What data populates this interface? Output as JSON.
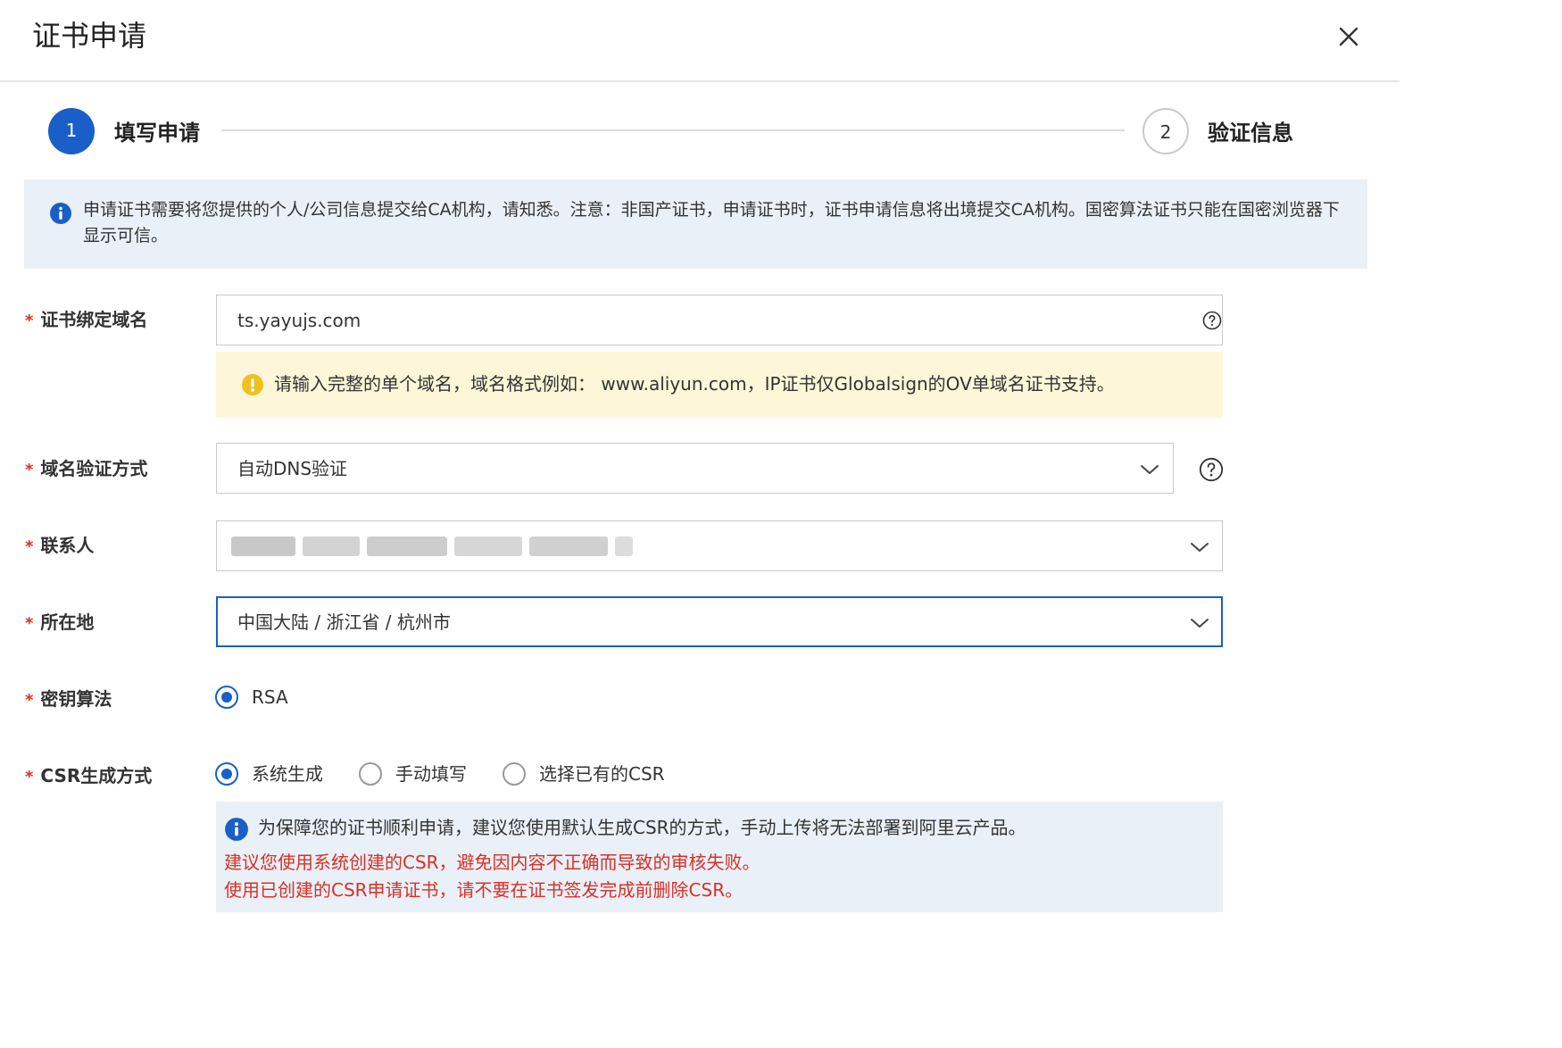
{
  "dialog": {
    "title": "证书申请"
  },
  "steps": [
    {
      "number": "1",
      "label": "填写申请"
    },
    {
      "number": "2",
      "label": "验证信息"
    }
  ],
  "notice": {
    "text": "申请证书需要将您提供的个人/公司信息提交给CA机构，请知悉。注意：非国产证书，申请证书时，证书申请信息将出境提交CA机构。国密算法证书只能在国密浏览器下显示可信。"
  },
  "form": {
    "required_mark": "*",
    "domain": {
      "label": "证书绑定域名",
      "value": "ts.yayujs.com",
      "hint": "请输入完整的单个域名，域名格式例如： www.aliyun.com，IP证书仅Globalsign的OV单域名证书支持。"
    },
    "verify_method": {
      "label": "域名验证方式",
      "value": "自动DNS验证"
    },
    "contact": {
      "label": "联系人"
    },
    "location": {
      "label": "所在地",
      "value": "中国大陆 / 浙江省 / 杭州市"
    },
    "algorithm": {
      "label": "密钥算法",
      "options": [
        {
          "label": "RSA",
          "selected": true
        }
      ]
    },
    "csr": {
      "label": "CSR生成方式",
      "options": [
        {
          "label": "系统生成",
          "selected": true
        },
        {
          "label": "手动填写",
          "selected": false
        },
        {
          "label": "选择已有的CSR",
          "selected": false
        }
      ],
      "info": {
        "line1": "为保障您的证书顺利申请，建议您使用默认生成CSR的方式，手动上传将无法部署到阿里云产品。",
        "line2": "建议您使用系统创建的CSR，避免因内容不正确而导致的审核失败。",
        "line3": "使用已创建的CSR申请证书，请不要在证书签发完成前删除CSR。"
      }
    }
  },
  "colors": {
    "primary": "#1a5fc7",
    "required": "#d93026",
    "warning_bg": "#fdf6d8",
    "info_bg": "#eaf0f7",
    "warning_icon": "#f0c020",
    "error_text": "#d93026"
  },
  "icons": [
    "close-icon",
    "info-icon",
    "warning-icon",
    "help-icon",
    "chevron-down-icon"
  ]
}
